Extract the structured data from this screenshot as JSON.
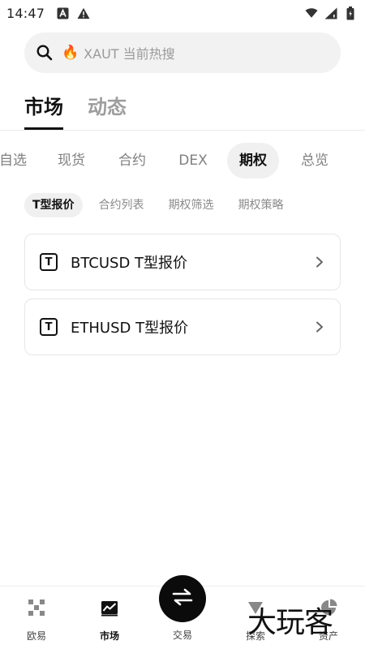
{
  "status_bar": {
    "time": "14:47",
    "left_icons": [
      "app-a-icon",
      "warning-icon"
    ],
    "right_icons": [
      "wifi-icon",
      "signal-icon",
      "battery-icon"
    ]
  },
  "search": {
    "placeholder": "XAUT 当前热搜",
    "hot_icon": "🔥"
  },
  "primary_tabs": [
    {
      "label": "市场",
      "active": true
    },
    {
      "label": "动态",
      "active": false
    }
  ],
  "categories": [
    {
      "label": "自选",
      "active": false
    },
    {
      "label": "现货",
      "active": false
    },
    {
      "label": "合约",
      "active": false
    },
    {
      "label": "DEX",
      "active": false
    },
    {
      "label": "期权",
      "active": true
    },
    {
      "label": "总览",
      "active": false
    }
  ],
  "sub_categories": [
    {
      "label": "T型报价",
      "active": true
    },
    {
      "label": "合约列表",
      "active": false
    },
    {
      "label": "期权筛选",
      "active": false
    },
    {
      "label": "期权策略",
      "active": false
    }
  ],
  "quote_cards": [
    {
      "badge": "T",
      "label": "BTCUSD T型报价"
    },
    {
      "badge": "T",
      "label": "ETHUSD T型报价"
    }
  ],
  "bottom_nav": {
    "items": [
      {
        "label": "欧易",
        "icon": "okx-logo-icon",
        "active": false
      },
      {
        "label": "市场",
        "icon": "market-chart-icon",
        "active": true
      },
      {
        "label": "交易",
        "icon": "swap-arrows-icon",
        "active": false
      },
      {
        "label": "探索",
        "icon": "explore-icon",
        "active": false
      },
      {
        "label": "资产",
        "icon": "assets-pie-icon",
        "active": false
      }
    ]
  },
  "watermark": "大玩客"
}
